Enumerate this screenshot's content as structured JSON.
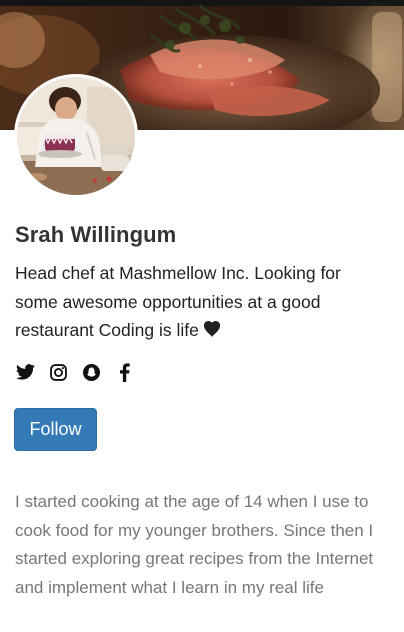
{
  "profile": {
    "name": "Srah Willingum",
    "bio": "Head chef at Mashmellow Inc. Looking for some awesome opportunities at a good restaurant Coding is life",
    "about": "I started cooking at the age of 14 when I use to cook food for my younger brothers. Since then I started exploring great recipes from the Internet and implement what I learn in my real life"
  },
  "social": [
    "twitter-icon",
    "instagram-icon",
    "snapchat-icon",
    "facebook-icon"
  ],
  "actions": {
    "follow_label": "Follow"
  },
  "colors": {
    "primary": "#337ab7",
    "name_text": "#333333",
    "about_text": "#777777"
  }
}
